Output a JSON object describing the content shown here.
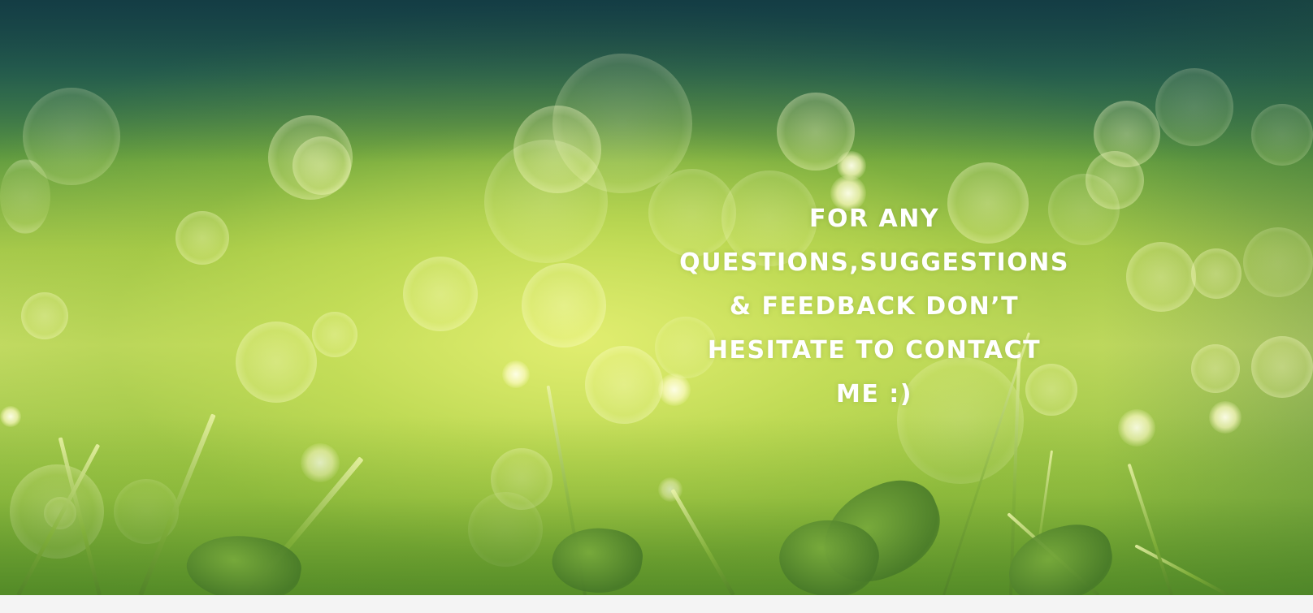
{
  "hero": {
    "message_lines": [
      "FOR ANY",
      "QUESTIONS,SUGGESTIONS",
      "& FEEDBACK DON’T",
      "HESITATE TO CONTACT",
      "ME :)"
    ]
  },
  "colors": {
    "message_text": "#ffffff",
    "top_shade": "#1e4d52",
    "bokeh_glow": "#e2ee70",
    "grass_green": "#6ea532",
    "page_strip": "#f4f4f4"
  }
}
